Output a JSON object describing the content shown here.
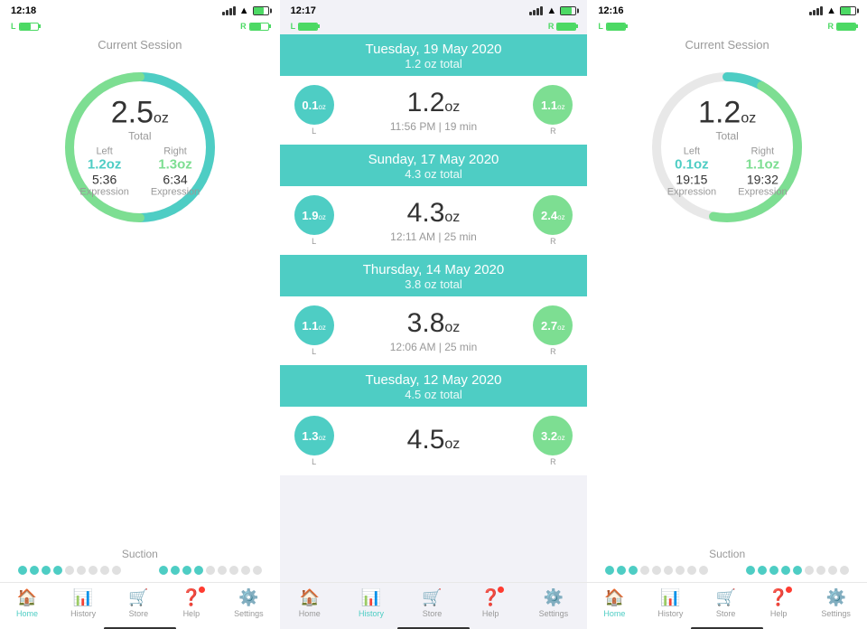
{
  "phones": [
    {
      "id": "left-phone",
      "time": "12:18",
      "battery_label": "L",
      "battery_r_label": "R",
      "screen": "session",
      "session": {
        "title": "Current Session",
        "total_value": "2.5",
        "total_unit": "oz",
        "total_label": "Total",
        "left_label": "Left",
        "right_label": "Right",
        "left_value": "1.2oz",
        "right_value": "1.3oz",
        "left_time": "5:36",
        "right_time": "6:34",
        "left_mode": "Expression",
        "right_mode": "Expression",
        "left_color": "teal",
        "right_color": "green",
        "gauge_left_pct": 0.48,
        "gauge_right_pct": 0.52,
        "suction_title": "Suction",
        "suction_filled": 4,
        "suction_total": 9,
        "suction2_filled": 4,
        "suction2_total": 9
      },
      "nav": {
        "items": [
          {
            "label": "Home",
            "icon": "🏠",
            "active": true
          },
          {
            "label": "History",
            "icon": "📊",
            "active": false
          },
          {
            "label": "Store",
            "icon": "🛒",
            "active": false
          },
          {
            "label": "Help",
            "icon": "❓",
            "active": false,
            "badge": true
          },
          {
            "label": "Settings",
            "icon": "⚙️",
            "active": false
          }
        ]
      }
    },
    {
      "id": "right-phone",
      "time": "12:16",
      "battery_label": "L",
      "battery_r_label": "R",
      "screen": "session",
      "session": {
        "title": "Current Session",
        "total_value": "1.2",
        "total_unit": "oz",
        "total_label": "Total",
        "left_label": "Left",
        "right_label": "Right",
        "left_value": "0.1oz",
        "right_value": "1.1oz",
        "left_time": "19:15",
        "right_time": "19:32",
        "left_mode": "Expression",
        "right_mode": "Expression",
        "left_color": "teal",
        "right_color": "green",
        "gauge_left_pct": 0.08,
        "gauge_right_pct": 0.44,
        "suction_title": "Suction",
        "suction_filled": 3,
        "suction_total": 9,
        "suction2_filled": 5,
        "suction2_total": 9
      },
      "nav": {
        "items": [
          {
            "label": "Home",
            "icon": "🏠",
            "active": true
          },
          {
            "label": "History",
            "icon": "📊",
            "active": false
          },
          {
            "label": "Store",
            "icon": "🛒",
            "active": false
          },
          {
            "label": "Help",
            "icon": "❓",
            "active": false,
            "badge": true
          },
          {
            "label": "Settings",
            "icon": "⚙️",
            "active": false
          }
        ]
      }
    }
  ],
  "history": {
    "status_time": "12:17",
    "battery_label": "L",
    "battery_r_label": "R",
    "dates": [
      {
        "date": "Tuesday, 19 May 2020",
        "total": "1.2 oz total",
        "sessions": [
          {
            "left_val": "0.1",
            "left_unit": "oz",
            "left_label": "L",
            "right_val": "1.1",
            "right_unit": "oz",
            "right_label": "R",
            "main_val": "1.2",
            "main_unit": "oz",
            "meta": "11:56 PM | 19 min"
          }
        ]
      },
      {
        "date": "Sunday, 17 May 2020",
        "total": "4.3 oz total",
        "sessions": [
          {
            "left_val": "1.9",
            "left_unit": "oz",
            "left_label": "L",
            "right_val": "2.4",
            "right_unit": "oz",
            "right_label": "R",
            "main_val": "4.3",
            "main_unit": "oz",
            "meta": "12:11 AM | 25 min"
          }
        ]
      },
      {
        "date": "Thursday, 14 May 2020",
        "total": "3.8 oz total",
        "sessions": [
          {
            "left_val": "1.1",
            "left_unit": "oz",
            "left_label": "L",
            "right_val": "2.7",
            "right_unit": "oz",
            "right_label": "R",
            "main_val": "3.8",
            "main_unit": "oz",
            "meta": "12:06 AM | 25 min"
          }
        ]
      },
      {
        "date": "Tuesday, 12 May 2020",
        "total": "4.5 oz total",
        "sessions": [
          {
            "left_val": "1.3",
            "left_unit": "oz",
            "left_label": "L",
            "right_val": "3.2",
            "right_unit": "oz",
            "right_label": "R",
            "main_val": "4.5",
            "main_unit": "oz",
            "meta": ""
          }
        ]
      }
    ],
    "nav": {
      "items": [
        {
          "label": "Home",
          "icon": "🏠",
          "active": false
        },
        {
          "label": "History",
          "icon": "📊",
          "active": true
        },
        {
          "label": "Store",
          "icon": "🛒",
          "active": false
        },
        {
          "label": "Help",
          "icon": "❓",
          "active": false,
          "badge": true
        },
        {
          "label": "Settings",
          "icon": "⚙️",
          "active": false
        }
      ]
    }
  },
  "colors": {
    "teal": "#4ecdc4",
    "green": "#7dde92",
    "accent": "#4ecdc4",
    "red_badge": "#ff3b30"
  }
}
